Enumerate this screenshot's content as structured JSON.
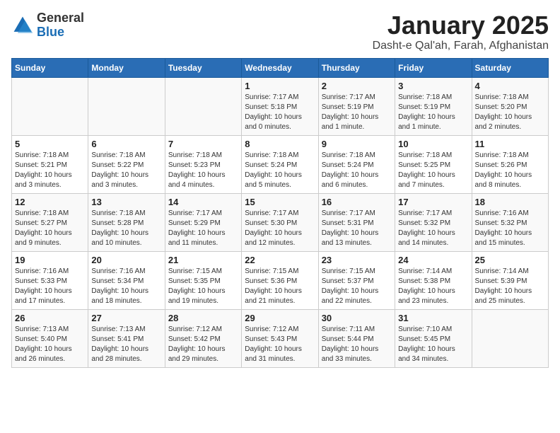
{
  "header": {
    "logo_general": "General",
    "logo_blue": "Blue",
    "title": "January 2025",
    "subtitle": "Dasht-e Qal'ah, Farah, Afghanistan"
  },
  "weekdays": [
    "Sunday",
    "Monday",
    "Tuesday",
    "Wednesday",
    "Thursday",
    "Friday",
    "Saturday"
  ],
  "weeks": [
    [
      {
        "day": "",
        "info": ""
      },
      {
        "day": "",
        "info": ""
      },
      {
        "day": "",
        "info": ""
      },
      {
        "day": "1",
        "info": "Sunrise: 7:17 AM\nSunset: 5:18 PM\nDaylight: 10 hours\nand 0 minutes."
      },
      {
        "day": "2",
        "info": "Sunrise: 7:17 AM\nSunset: 5:19 PM\nDaylight: 10 hours\nand 1 minute."
      },
      {
        "day": "3",
        "info": "Sunrise: 7:18 AM\nSunset: 5:19 PM\nDaylight: 10 hours\nand 1 minute."
      },
      {
        "day": "4",
        "info": "Sunrise: 7:18 AM\nSunset: 5:20 PM\nDaylight: 10 hours\nand 2 minutes."
      }
    ],
    [
      {
        "day": "5",
        "info": "Sunrise: 7:18 AM\nSunset: 5:21 PM\nDaylight: 10 hours\nand 3 minutes."
      },
      {
        "day": "6",
        "info": "Sunrise: 7:18 AM\nSunset: 5:22 PM\nDaylight: 10 hours\nand 3 minutes."
      },
      {
        "day": "7",
        "info": "Sunrise: 7:18 AM\nSunset: 5:23 PM\nDaylight: 10 hours\nand 4 minutes."
      },
      {
        "day": "8",
        "info": "Sunrise: 7:18 AM\nSunset: 5:24 PM\nDaylight: 10 hours\nand 5 minutes."
      },
      {
        "day": "9",
        "info": "Sunrise: 7:18 AM\nSunset: 5:24 PM\nDaylight: 10 hours\nand 6 minutes."
      },
      {
        "day": "10",
        "info": "Sunrise: 7:18 AM\nSunset: 5:25 PM\nDaylight: 10 hours\nand 7 minutes."
      },
      {
        "day": "11",
        "info": "Sunrise: 7:18 AM\nSunset: 5:26 PM\nDaylight: 10 hours\nand 8 minutes."
      }
    ],
    [
      {
        "day": "12",
        "info": "Sunrise: 7:18 AM\nSunset: 5:27 PM\nDaylight: 10 hours\nand 9 minutes."
      },
      {
        "day": "13",
        "info": "Sunrise: 7:18 AM\nSunset: 5:28 PM\nDaylight: 10 hours\nand 10 minutes."
      },
      {
        "day": "14",
        "info": "Sunrise: 7:17 AM\nSunset: 5:29 PM\nDaylight: 10 hours\nand 11 minutes."
      },
      {
        "day": "15",
        "info": "Sunrise: 7:17 AM\nSunset: 5:30 PM\nDaylight: 10 hours\nand 12 minutes."
      },
      {
        "day": "16",
        "info": "Sunrise: 7:17 AM\nSunset: 5:31 PM\nDaylight: 10 hours\nand 13 minutes."
      },
      {
        "day": "17",
        "info": "Sunrise: 7:17 AM\nSunset: 5:32 PM\nDaylight: 10 hours\nand 14 minutes."
      },
      {
        "day": "18",
        "info": "Sunrise: 7:16 AM\nSunset: 5:32 PM\nDaylight: 10 hours\nand 15 minutes."
      }
    ],
    [
      {
        "day": "19",
        "info": "Sunrise: 7:16 AM\nSunset: 5:33 PM\nDaylight: 10 hours\nand 17 minutes."
      },
      {
        "day": "20",
        "info": "Sunrise: 7:16 AM\nSunset: 5:34 PM\nDaylight: 10 hours\nand 18 minutes."
      },
      {
        "day": "21",
        "info": "Sunrise: 7:15 AM\nSunset: 5:35 PM\nDaylight: 10 hours\nand 19 minutes."
      },
      {
        "day": "22",
        "info": "Sunrise: 7:15 AM\nSunset: 5:36 PM\nDaylight: 10 hours\nand 21 minutes."
      },
      {
        "day": "23",
        "info": "Sunrise: 7:15 AM\nSunset: 5:37 PM\nDaylight: 10 hours\nand 22 minutes."
      },
      {
        "day": "24",
        "info": "Sunrise: 7:14 AM\nSunset: 5:38 PM\nDaylight: 10 hours\nand 23 minutes."
      },
      {
        "day": "25",
        "info": "Sunrise: 7:14 AM\nSunset: 5:39 PM\nDaylight: 10 hours\nand 25 minutes."
      }
    ],
    [
      {
        "day": "26",
        "info": "Sunrise: 7:13 AM\nSunset: 5:40 PM\nDaylight: 10 hours\nand 26 minutes."
      },
      {
        "day": "27",
        "info": "Sunrise: 7:13 AM\nSunset: 5:41 PM\nDaylight: 10 hours\nand 28 minutes."
      },
      {
        "day": "28",
        "info": "Sunrise: 7:12 AM\nSunset: 5:42 PM\nDaylight: 10 hours\nand 29 minutes."
      },
      {
        "day": "29",
        "info": "Sunrise: 7:12 AM\nSunset: 5:43 PM\nDaylight: 10 hours\nand 31 minutes."
      },
      {
        "day": "30",
        "info": "Sunrise: 7:11 AM\nSunset: 5:44 PM\nDaylight: 10 hours\nand 33 minutes."
      },
      {
        "day": "31",
        "info": "Sunrise: 7:10 AM\nSunset: 5:45 PM\nDaylight: 10 hours\nand 34 minutes."
      },
      {
        "day": "",
        "info": ""
      }
    ]
  ]
}
